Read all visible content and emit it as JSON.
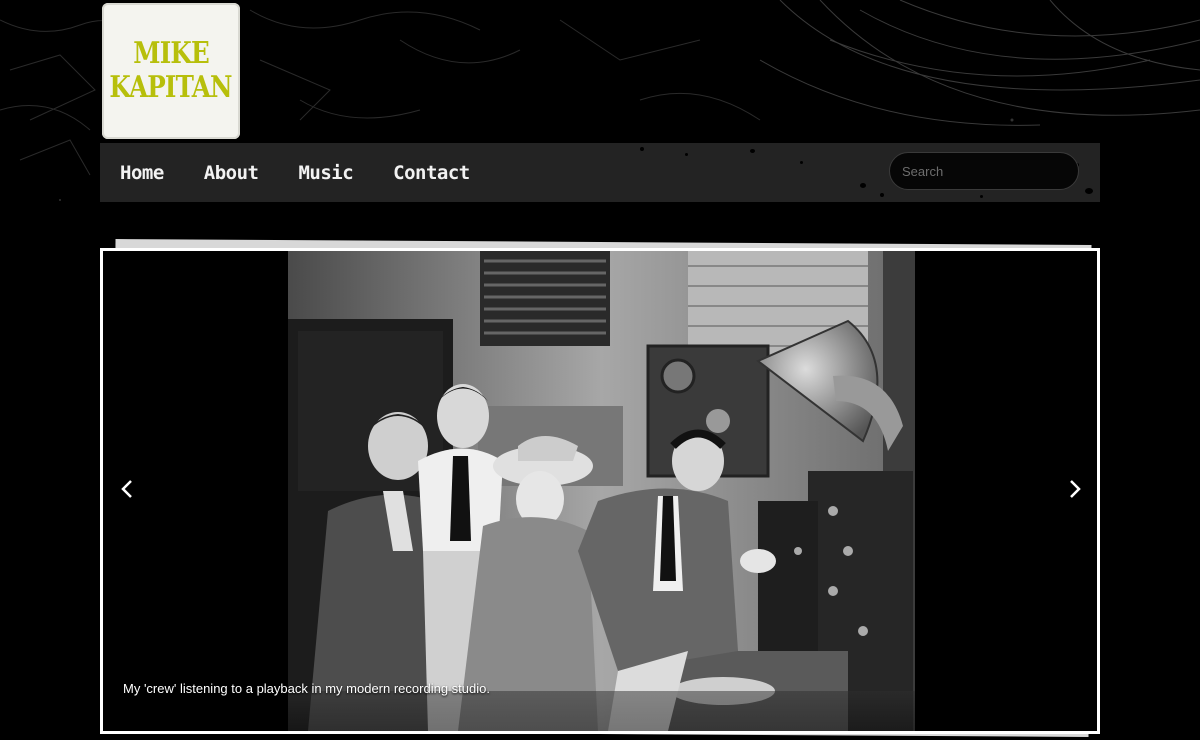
{
  "brand": {
    "line1": "MIKE",
    "line2": "KAPITAN",
    "color": "#b7bf0b"
  },
  "nav": {
    "items": [
      {
        "label": "Home"
      },
      {
        "label": "About"
      },
      {
        "label": "Music"
      },
      {
        "label": "Contact"
      }
    ]
  },
  "search": {
    "placeholder": "Search",
    "value": ""
  },
  "slider": {
    "caption": "My 'crew' listening to a playback in my modern recording studio.",
    "prev_icon": "chevron-left-icon",
    "next_icon": "chevron-right-icon",
    "photo": "vintage black-and-white photo of people gathered around an early radio recording set"
  }
}
